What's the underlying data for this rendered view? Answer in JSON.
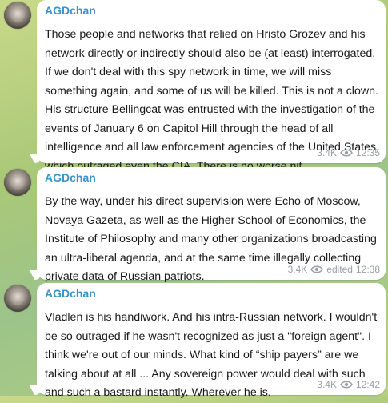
{
  "messages": [
    {
      "author": "AGDchan",
      "text": "Those people and networks that relied on Hristo Grozev and his network directly or indirectly should also be (at least) interrogated. If we don't deal with this spy network in time, we will miss something again, and some of us will be killed. This is not a clown. His structure Bellingcat was entrusted with the investigation of the events of January 6 on Capitol Hill through the head of all intelligence and all law enforcement agencies of the United States, which outraged even the CIA. There is no worse nit.",
      "views": "3.4K",
      "edited": "",
      "time": "12:35"
    },
    {
      "author": "AGDchan",
      "text": "By the way, under his direct supervision were Echo of Moscow, Novaya Gazeta, as well as the Higher School of Economics, the Institute of Philosophy and many other organizations broadcasting an ultra-liberal agenda, and at the same time illegally collecting private data of Russian patriots.",
      "views": "3.4K",
      "edited": "edited",
      "time": "12:38"
    },
    {
      "author": "AGDchan",
      "text": "Vladlen is his handiwork. And his intra-Russian network. I wouldn't be so outraged if he wasn't recognized as just a \"foreign agent\". I think we're out of our minds. What kind of “ship payers” are we talking about at all ... Any sovereign power would deal with such and such a bastard instantly. Wherever he is.",
      "views": "3.4K",
      "edited": "",
      "time": "12:42"
    }
  ],
  "icons": {
    "views": "eye-icon"
  },
  "colors": {
    "author": "#3a93c8",
    "meta": "#9aa0a6",
    "bubble": "#ffffff"
  }
}
